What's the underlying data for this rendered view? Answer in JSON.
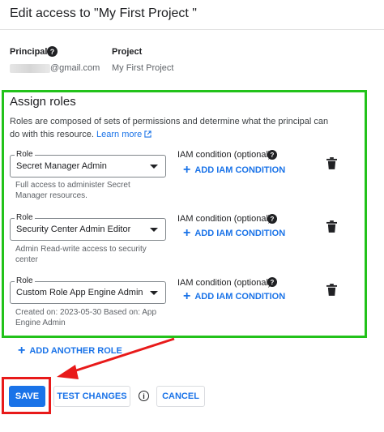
{
  "header": {
    "title": "Edit access to \"My First Project \""
  },
  "info": {
    "principal_label": "Principal",
    "principal_value": "@gmail.com",
    "project_label": "Project",
    "project_value": "My First Project"
  },
  "assign_roles": {
    "title": "Assign roles",
    "description": "Roles are composed of sets of permissions and determine what the principal can do with this resource.",
    "learn_more": "Learn more",
    "roles": [
      {
        "label": "Role",
        "value": "Secret Manager Admin",
        "help_line1": "Full access to administer Secret",
        "help_line2": "Manager resources.",
        "iam_label": "IAM condition (optional)",
        "add_condition": "ADD IAM CONDITION"
      },
      {
        "label": "Role",
        "value": "Security Center Admin Editor",
        "help_line1": "Admin Read-write access to security",
        "help_line2": "center",
        "iam_label": "IAM condition (optional)",
        "add_condition": "ADD IAM CONDITION"
      },
      {
        "label": "Role",
        "value": "Custom Role App Engine Admin",
        "help_line1": "Created on: 2023-05-30 Based on: App",
        "help_line2": "Engine Admin",
        "iam_label": "IAM condition (optional)",
        "add_condition": "ADD IAM CONDITION"
      }
    ],
    "add_another_role": "ADD ANOTHER ROLE"
  },
  "actions": {
    "save": "SAVE",
    "test_changes": "TEST CHANGES",
    "cancel": "CANCEL"
  },
  "colors": {
    "accent": "#1a73e8",
    "highlight_green": "#22c21a",
    "annotation_red": "#e81a1a"
  },
  "icons": {
    "help": "help-circle-icon",
    "delete": "trash-icon",
    "external": "external-link-icon",
    "add": "plus-icon",
    "dropdown": "caret-down-icon",
    "info": "info-icon"
  }
}
